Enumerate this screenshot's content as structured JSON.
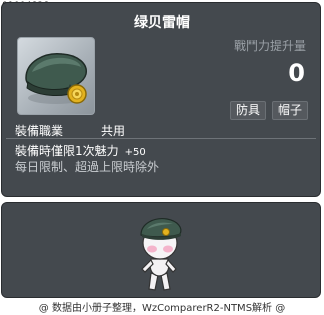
{
  "item_id": "01004828",
  "title": "绿贝雷帽",
  "combat_power": {
    "label": "戰鬥力提升量",
    "value": "0"
  },
  "tags": [
    "防具",
    "帽子"
  ],
  "job_requirement": {
    "label": "裝備職業",
    "value": "共用"
  },
  "effect": {
    "text": "裝備時僅限1次魅力",
    "value": "+50"
  },
  "limit_text": "每日限制、超過上限時除外",
  "footer": "@ 数据由小册子整理，WzComparerR2-NTMS解析 @",
  "icons": {
    "item": "green-beret-icon",
    "avatar": "character-wearing-beret"
  },
  "colors": {
    "panel": "#44494e",
    "icon_bg": "#c0c7cd",
    "beret": "#3f5a4e",
    "badge": "#e3b21f"
  }
}
